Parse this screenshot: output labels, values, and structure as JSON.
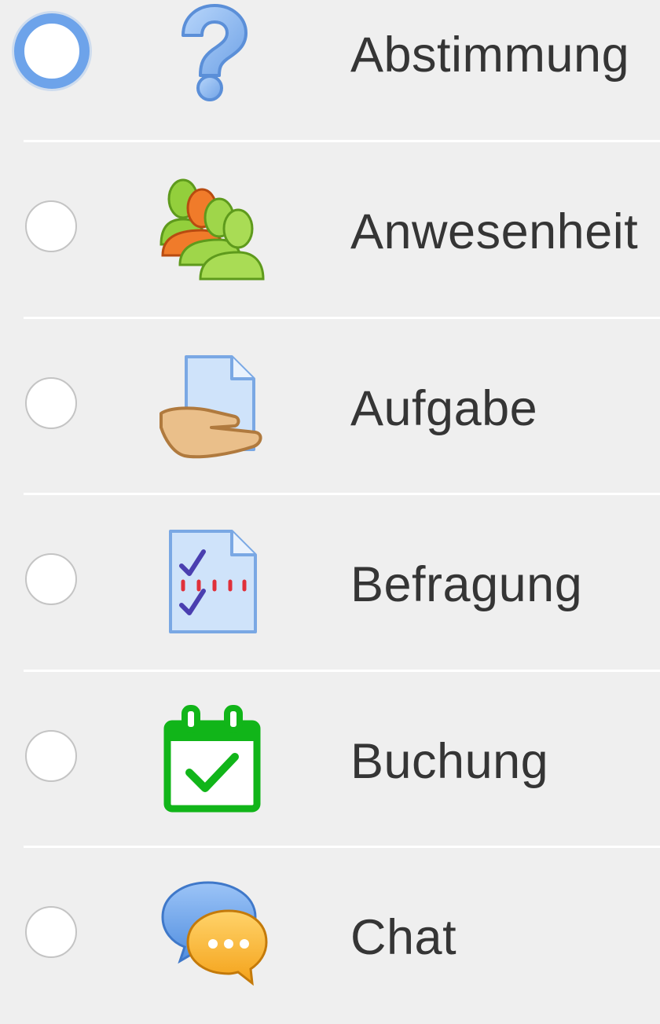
{
  "activities": [
    {
      "label": "Abstimmung",
      "icon": "question-mark-icon",
      "selected": true
    },
    {
      "label": "Anwesenheit",
      "icon": "people-group-icon",
      "selected": false
    },
    {
      "label": "Aufgabe",
      "icon": "hand-document-icon",
      "selected": false
    },
    {
      "label": "Befragung",
      "icon": "checklist-document-icon",
      "selected": false
    },
    {
      "label": "Buchung",
      "icon": "calendar-check-icon",
      "selected": false
    },
    {
      "label": "Chat",
      "icon": "chat-bubbles-icon",
      "selected": false
    }
  ],
  "colors": {
    "background": "#efefef",
    "selected_radio": "#6da3ea",
    "divider": "#ffffff",
    "text": "#353535"
  }
}
